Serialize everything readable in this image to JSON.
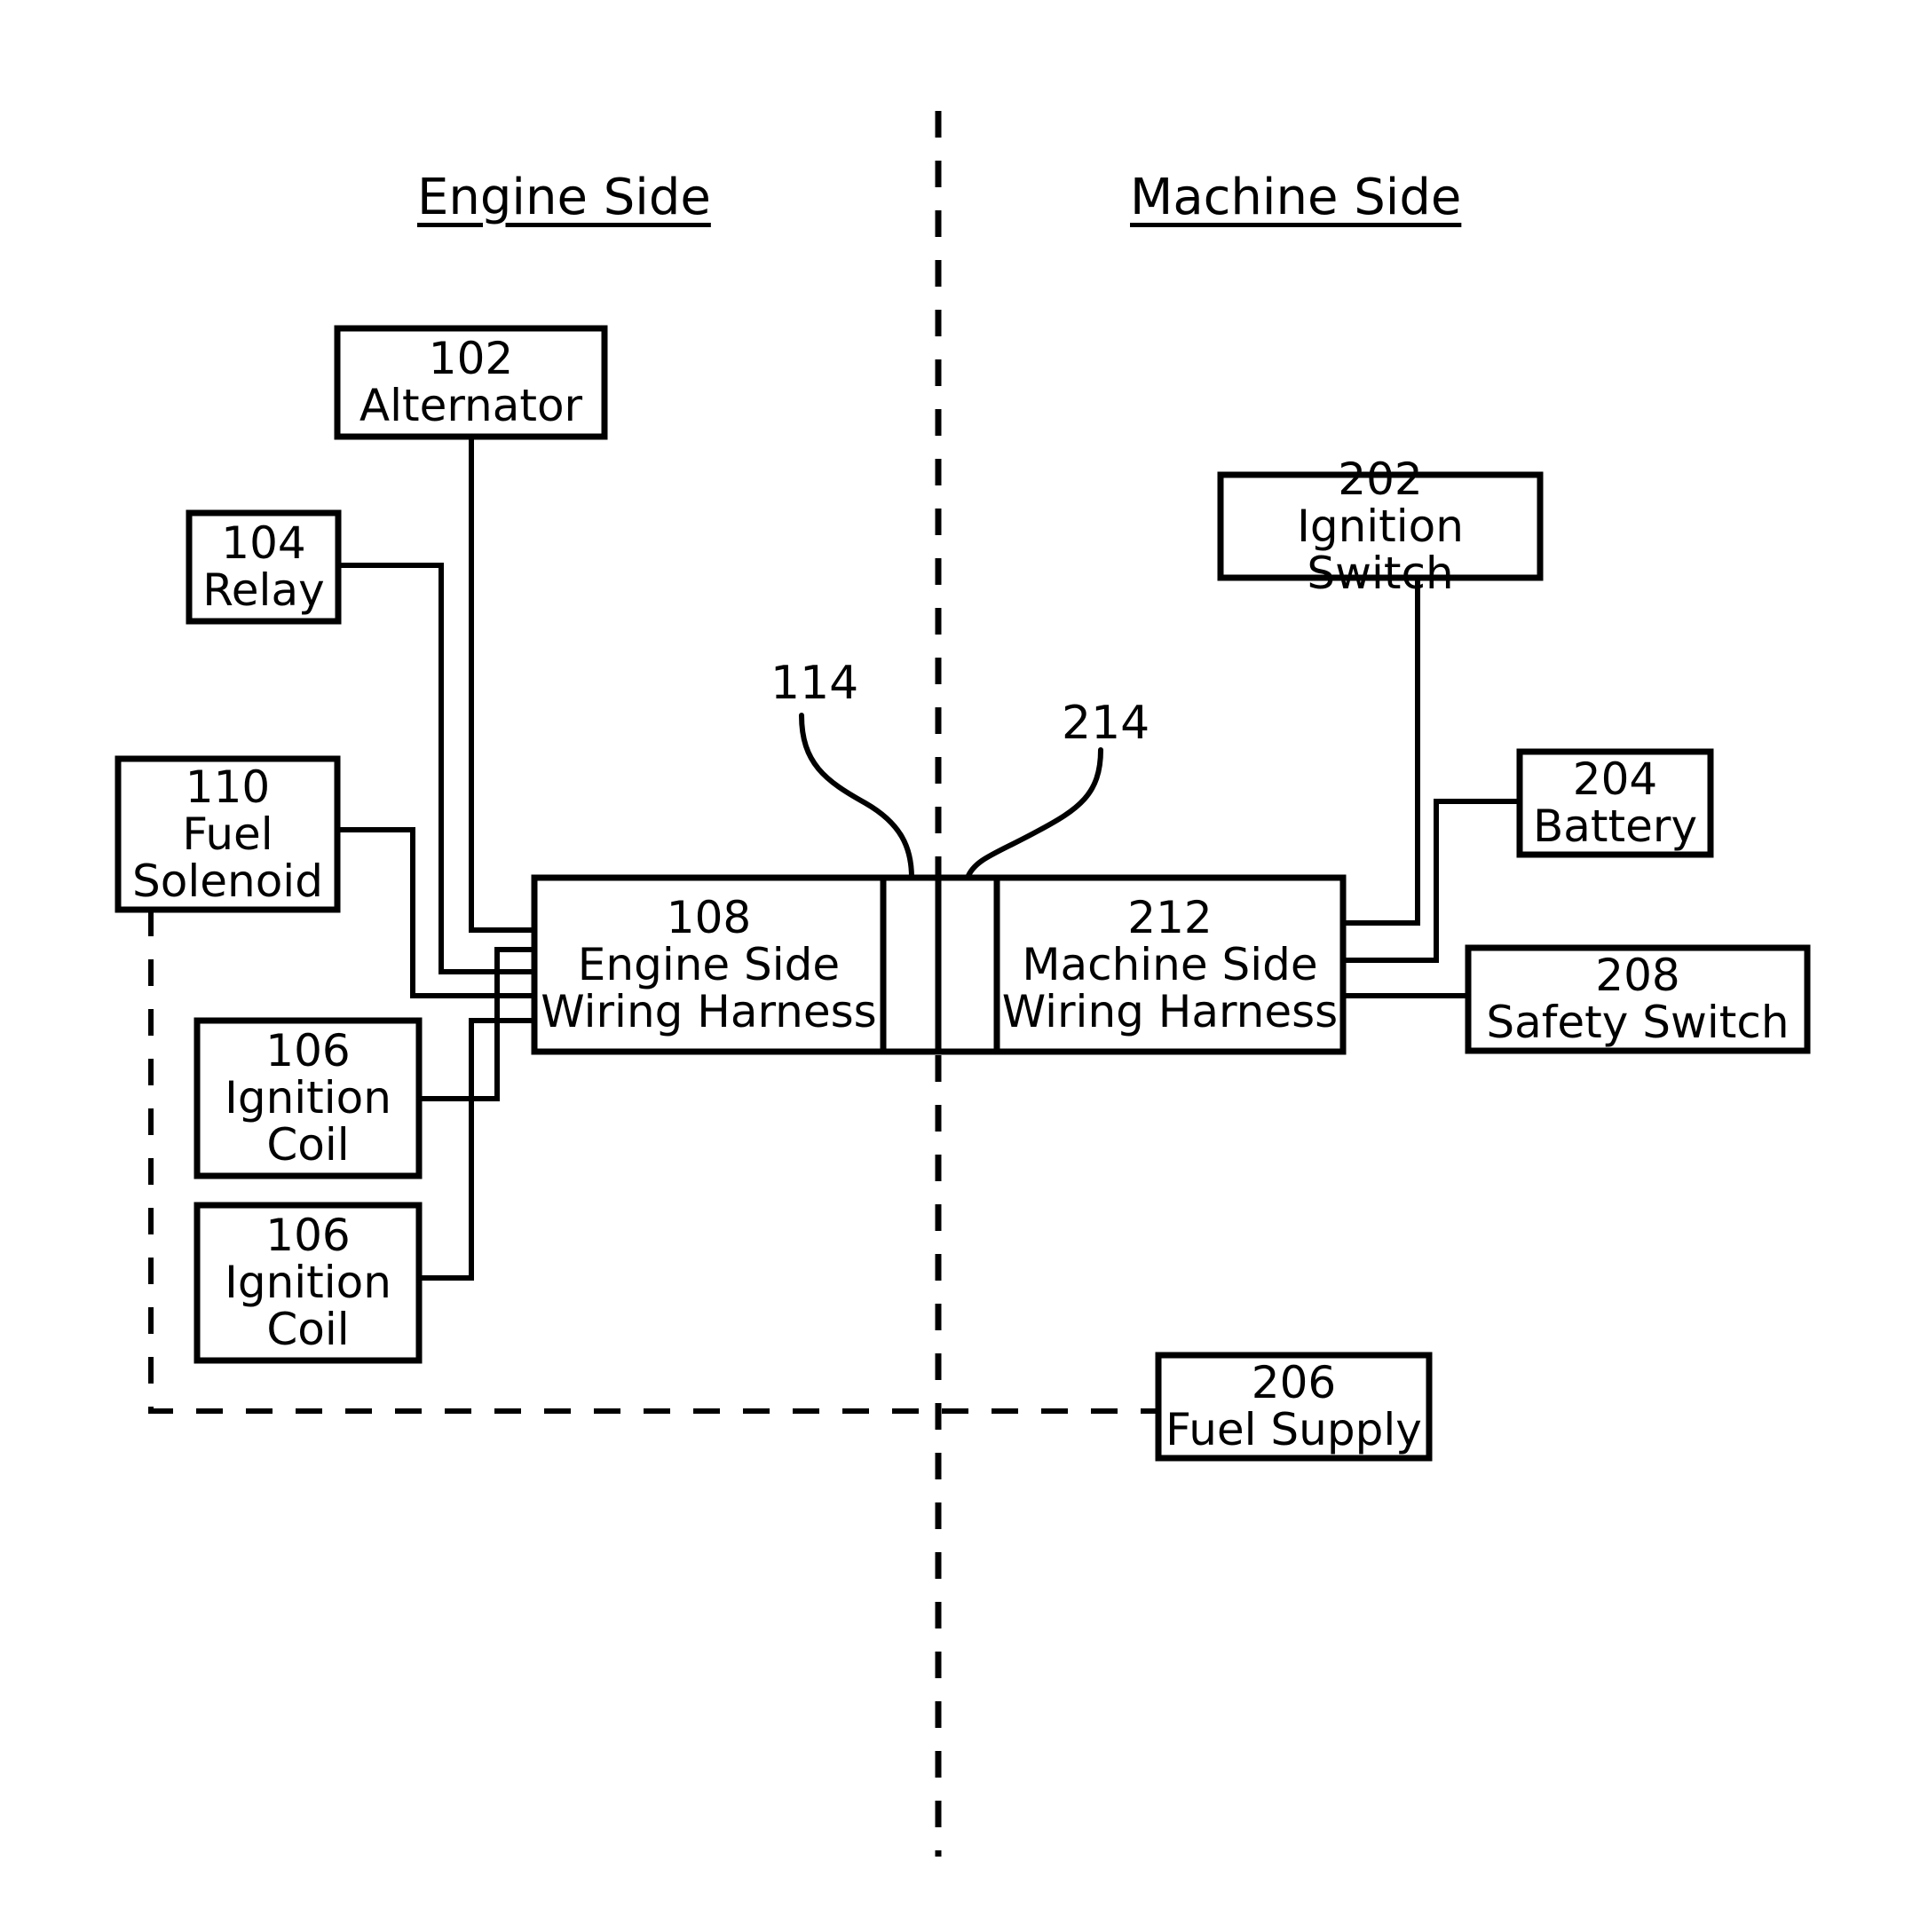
{
  "figure": {
    "type": "patent-block-diagram",
    "titles": {
      "left": "Engine Side",
      "right": "Machine Side"
    },
    "divider": {
      "style": "dashed-vertical",
      "color": "#000000"
    }
  },
  "engine_side": {
    "blocks": [
      {
        "id": "alternator",
        "number": "102",
        "name": "Alternator"
      },
      {
        "id": "relay",
        "number": "104",
        "name": "Relay"
      },
      {
        "id": "fuel-solenoid",
        "number": "110",
        "name": "Fuel\nSolenoid",
        "line1": "Fuel",
        "line2": "Solenoid"
      },
      {
        "id": "ignition-coil-1",
        "number": "106",
        "name": "Ignition\nCoil",
        "line1": "Ignition",
        "line2": "Coil"
      },
      {
        "id": "ignition-coil-2",
        "number": "106",
        "name": "Ignition\nCoil",
        "line1": "Ignition",
        "line2": "Coil"
      },
      {
        "id": "engine-harness",
        "number": "108",
        "name": "Engine Side\nWiring Harness",
        "line1": "Engine Side",
        "line2": "Wiring Harness"
      }
    ],
    "connector_label": "114"
  },
  "machine_side": {
    "blocks": [
      {
        "id": "ignition-switch",
        "number": "202",
        "name": "Ignition Switch"
      },
      {
        "id": "battery",
        "number": "204",
        "name": "Battery"
      },
      {
        "id": "safety-switch",
        "number": "208",
        "name": "Safety Switch"
      },
      {
        "id": "fuel-supply",
        "number": "206",
        "name": "Fuel Supply"
      },
      {
        "id": "machine-harness",
        "number": "212",
        "name": "Machine Side\nWiring Harness",
        "line1": "Machine Side",
        "line2": "Wiring Harness"
      }
    ],
    "connector_label": "214"
  },
  "labels": {
    "engine_side_title": "Engine Side",
    "machine_side_title": "Machine Side",
    "alternator_num": "102",
    "alternator_name": "Alternator",
    "relay_num": "104",
    "relay_name": "Relay",
    "fuel_solenoid_num": "110",
    "fuel_solenoid_l1": "Fuel",
    "fuel_solenoid_l2": "Solenoid",
    "coil1_num": "106",
    "coil1_l1": "Ignition",
    "coil1_l2": "Coil",
    "coil2_num": "106",
    "coil2_l1": "Ignition",
    "coil2_l2": "Coil",
    "engine_harness_num": "108",
    "engine_harness_l1": "Engine Side",
    "engine_harness_l2": "Wiring Harness",
    "machine_harness_num": "212",
    "machine_harness_l1": "Machine Side",
    "machine_harness_l2": "Wiring Harness",
    "connector_114": "114",
    "connector_214": "214",
    "ignition_switch_num": "202",
    "ignition_switch_name": "Ignition Switch",
    "battery_num": "204",
    "battery_name": "Battery",
    "safety_switch_num": "208",
    "safety_switch_name": "Safety Switch",
    "fuel_supply_num": "206",
    "fuel_supply_name": "Fuel Supply"
  }
}
